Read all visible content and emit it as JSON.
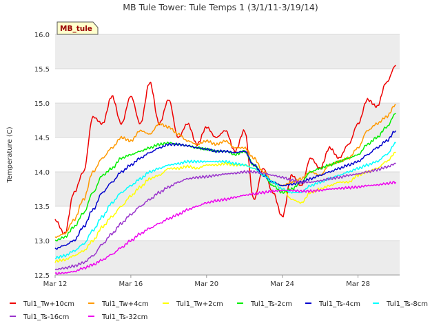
{
  "chart_data": {
    "type": "line",
    "title": "MB Tule Tower: Tule Temps 1 (3/1/11-3/19/14)",
    "site_label": "MB_tule",
    "xlabel": "",
    "ylabel": "Temperature (C)",
    "ylim": [
      12.5,
      16.0
    ],
    "y_ticks": [
      "12.5",
      "13.0",
      "13.5",
      "14.0",
      "14.5",
      "15.0",
      "15.5",
      "16.0"
    ],
    "x_ticks": [
      "Mar 12",
      "Mar 16",
      "Mar 20",
      "Mar 24",
      "Mar 28"
    ],
    "xlim": [
      12,
      30.2
    ],
    "grid": true,
    "legend_position": "bottom",
    "colors": {
      "band": "#ececec",
      "grid": "#d9d9d9",
      "axis": "#999999"
    },
    "series": [
      {
        "name": "Tul1_Tw+10cm",
        "color": "#ee0000",
        "x": [
          12.0,
          12.5,
          13.0,
          13.5,
          14.0,
          14.5,
          15.0,
          15.5,
          16.0,
          16.5,
          17.0,
          17.5,
          18.0,
          18.5,
          19.0,
          19.5,
          20.0,
          20.5,
          21.0,
          21.5,
          22.0,
          22.5,
          23.0,
          23.5,
          24.0,
          24.5,
          25.0,
          25.5,
          26.0,
          26.5,
          27.0,
          27.5,
          28.0,
          28.5,
          29.0,
          29.5,
          30.0
        ],
        "values": [
          13.3,
          13.1,
          13.7,
          14.0,
          14.8,
          14.7,
          15.1,
          14.7,
          15.1,
          14.7,
          15.3,
          14.7,
          15.05,
          14.5,
          14.7,
          14.4,
          14.65,
          14.5,
          14.6,
          14.3,
          14.6,
          13.6,
          14.05,
          13.7,
          13.35,
          13.95,
          13.8,
          14.2,
          14.05,
          14.35,
          14.2,
          14.4,
          14.7,
          15.05,
          14.95,
          15.3,
          15.55
        ]
      },
      {
        "name": "Tul1_Tw+4cm",
        "color": "#ff9900",
        "x": [
          12.0,
          12.5,
          13.0,
          13.5,
          14.0,
          14.5,
          15.0,
          15.5,
          16.0,
          16.5,
          17.0,
          17.5,
          18.0,
          18.5,
          19.0,
          19.5,
          20.0,
          20.5,
          21.0,
          21.5,
          22.0,
          22.5,
          23.0,
          23.5,
          24.0,
          24.5,
          25.0,
          25.5,
          26.0,
          26.5,
          27.0,
          27.5,
          28.0,
          28.5,
          29.0,
          29.5,
          30.0
        ],
        "values": [
          13.05,
          13.1,
          13.3,
          13.6,
          14.0,
          14.2,
          14.35,
          14.5,
          14.45,
          14.6,
          14.55,
          14.7,
          14.65,
          14.55,
          14.45,
          14.4,
          14.45,
          14.4,
          14.45,
          14.35,
          14.35,
          14.2,
          14.0,
          13.85,
          13.8,
          13.85,
          13.9,
          14.0,
          13.95,
          14.1,
          14.15,
          14.2,
          14.35,
          14.6,
          14.7,
          14.8,
          14.98
        ]
      },
      {
        "name": "Tul1_Tw+2cm",
        "color": "#ffff00",
        "x": [
          12.0,
          12.5,
          13.0,
          13.5,
          14.0,
          14.5,
          15.0,
          15.5,
          16.0,
          16.5,
          17.0,
          17.5,
          18.0,
          18.5,
          19.0,
          19.5,
          20.0,
          20.5,
          21.0,
          21.5,
          22.0,
          22.5,
          23.0,
          23.5,
          24.0,
          24.5,
          25.0,
          25.5,
          26.0,
          26.5,
          27.0,
          27.5,
          28.0,
          28.5,
          29.0,
          29.5,
          30.0
        ],
        "values": [
          12.7,
          12.72,
          12.78,
          12.85,
          13.0,
          13.2,
          13.35,
          13.5,
          13.65,
          13.78,
          13.9,
          13.95,
          14.05,
          14.05,
          14.08,
          14.05,
          14.1,
          14.1,
          14.12,
          14.1,
          14.1,
          14.05,
          13.95,
          13.85,
          13.75,
          13.6,
          13.55,
          13.7,
          13.75,
          13.8,
          13.85,
          13.85,
          13.95,
          14.0,
          14.05,
          14.15,
          14.28
        ]
      },
      {
        "name": "Tul1_Ts-2cm",
        "color": "#00ee00",
        "x": [
          12.0,
          12.5,
          13.0,
          13.5,
          14.0,
          14.5,
          15.0,
          15.5,
          16.0,
          16.5,
          17.0,
          17.5,
          18.0,
          18.5,
          19.0,
          19.5,
          20.0,
          20.5,
          21.0,
          21.5,
          22.0,
          22.5,
          23.0,
          23.5,
          24.0,
          24.5,
          25.0,
          25.5,
          26.0,
          26.5,
          27.0,
          27.5,
          28.0,
          28.5,
          29.0,
          29.5,
          30.0
        ],
        "values": [
          13.0,
          13.05,
          13.2,
          13.4,
          13.7,
          13.95,
          14.05,
          14.2,
          14.25,
          14.3,
          14.35,
          14.4,
          14.42,
          14.4,
          14.38,
          14.35,
          14.33,
          14.3,
          14.3,
          14.25,
          14.3,
          14.1,
          13.95,
          13.8,
          13.7,
          13.75,
          13.85,
          14.0,
          14.05,
          14.1,
          14.15,
          14.2,
          14.25,
          14.4,
          14.5,
          14.65,
          14.85
        ]
      },
      {
        "name": "Tul1_Ts-4cm",
        "color": "#0000cc",
        "x": [
          12.0,
          12.5,
          13.0,
          13.5,
          14.0,
          14.5,
          15.0,
          15.5,
          16.0,
          16.5,
          17.0,
          17.5,
          18.0,
          18.5,
          19.0,
          19.5,
          20.0,
          20.5,
          21.0,
          21.5,
          22.0,
          22.5,
          23.0,
          23.5,
          24.0,
          24.5,
          25.0,
          25.5,
          26.0,
          26.5,
          27.0,
          27.5,
          28.0,
          28.5,
          29.0,
          29.5,
          30.0
        ],
        "values": [
          12.88,
          12.93,
          13.0,
          13.2,
          13.45,
          13.7,
          13.85,
          14.0,
          14.1,
          14.2,
          14.28,
          14.35,
          14.4,
          14.4,
          14.38,
          14.35,
          14.33,
          14.3,
          14.3,
          14.28,
          14.3,
          14.1,
          13.95,
          13.85,
          13.8,
          13.82,
          13.85,
          13.9,
          13.95,
          14.0,
          14.05,
          14.1,
          14.15,
          14.25,
          14.35,
          14.45,
          14.6
        ]
      },
      {
        "name": "Tul1_Ts-8cm",
        "color": "#00ffff",
        "x": [
          12.0,
          12.5,
          13.0,
          13.5,
          14.0,
          14.5,
          15.0,
          15.5,
          16.0,
          16.5,
          17.0,
          17.5,
          18.0,
          18.5,
          19.0,
          19.5,
          20.0,
          20.5,
          21.0,
          21.5,
          22.0,
          22.5,
          23.0,
          23.5,
          24.0,
          24.5,
          25.0,
          25.5,
          26.0,
          26.5,
          27.0,
          27.5,
          28.0,
          28.5,
          29.0,
          29.5,
          30.0
        ],
        "values": [
          12.75,
          12.78,
          12.85,
          12.95,
          13.15,
          13.35,
          13.55,
          13.7,
          13.8,
          13.9,
          14.0,
          14.05,
          14.1,
          14.12,
          14.15,
          14.15,
          14.15,
          14.15,
          14.15,
          14.12,
          14.1,
          14.05,
          13.95,
          13.85,
          13.75,
          13.7,
          13.7,
          13.8,
          13.85,
          13.9,
          13.95,
          14.0,
          14.05,
          14.1,
          14.15,
          14.25,
          14.42
        ]
      },
      {
        "name": "Tul1_Ts-16cm",
        "color": "#9933cc",
        "x": [
          12.0,
          12.5,
          13.0,
          13.5,
          14.0,
          14.5,
          15.0,
          15.5,
          16.0,
          16.5,
          17.0,
          17.5,
          18.0,
          18.5,
          19.0,
          19.5,
          20.0,
          20.5,
          21.0,
          21.5,
          22.0,
          22.5,
          23.0,
          23.5,
          24.0,
          24.5,
          25.0,
          25.5,
          26.0,
          26.5,
          27.0,
          27.5,
          28.0,
          28.5,
          29.0,
          29.5,
          30.0
        ],
        "values": [
          12.58,
          12.6,
          12.63,
          12.68,
          12.78,
          12.95,
          13.1,
          13.25,
          13.38,
          13.5,
          13.6,
          13.7,
          13.78,
          13.85,
          13.9,
          13.92,
          13.93,
          13.95,
          13.97,
          13.98,
          14.0,
          14.0,
          13.98,
          13.95,
          13.92,
          13.88,
          13.85,
          13.85,
          13.87,
          13.9,
          13.92,
          13.95,
          13.97,
          14.0,
          14.03,
          14.07,
          14.12
        ]
      },
      {
        "name": "Tul1_Ts-32cm",
        "color": "#ee00ee",
        "x": [
          12.0,
          12.5,
          13.0,
          13.5,
          14.0,
          14.5,
          15.0,
          15.5,
          16.0,
          16.5,
          17.0,
          17.5,
          18.0,
          18.5,
          19.0,
          19.5,
          20.0,
          20.5,
          21.0,
          21.5,
          22.0,
          22.5,
          23.0,
          23.5,
          24.0,
          24.5,
          25.0,
          25.5,
          26.0,
          26.5,
          27.0,
          27.5,
          28.0,
          28.5,
          29.0,
          29.5,
          30.0
        ],
        "values": [
          12.52,
          12.53,
          12.55,
          12.6,
          12.65,
          12.72,
          12.8,
          12.9,
          13.0,
          13.1,
          13.18,
          13.25,
          13.32,
          13.38,
          13.45,
          13.5,
          13.55,
          13.58,
          13.6,
          13.63,
          13.66,
          13.68,
          13.7,
          13.72,
          13.73,
          13.73,
          13.72,
          13.72,
          13.73,
          13.75,
          13.76,
          13.77,
          13.78,
          13.8,
          13.81,
          13.83,
          13.85
        ]
      }
    ]
  }
}
